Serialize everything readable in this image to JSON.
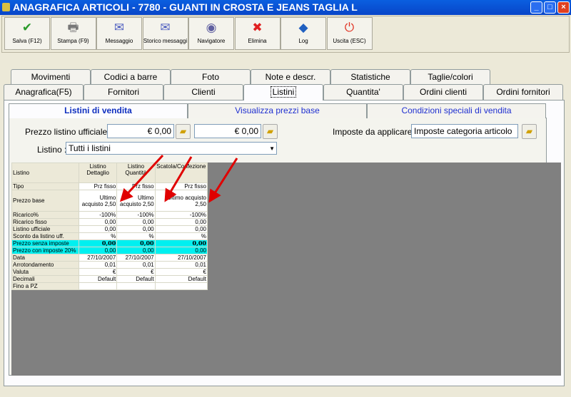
{
  "window": {
    "title": "ANAGRAFICA ARTICOLI - 7780 - GUANTI IN CROSTA E JEANS TAGLIA L"
  },
  "toolbar": [
    {
      "label": "Salva (F12)",
      "icon": "check-icon",
      "color": "#2a9a2a",
      "glyph": "✔"
    },
    {
      "label": "Stampa (F9)",
      "icon": "printer-icon",
      "color": "#777",
      "glyph": "🖶"
    },
    {
      "label": "Messaggio",
      "icon": "mail-pen-icon",
      "color": "#5060c0",
      "glyph": "✉"
    },
    {
      "label": "Storico messaggi",
      "icon": "mail-search-icon",
      "color": "#5060c0",
      "glyph": "✉"
    },
    {
      "label": "Navigatore",
      "icon": "compass-icon",
      "color": "#6060a0",
      "glyph": "◉"
    },
    {
      "label": "Elimina",
      "icon": "x-icon",
      "color": "#e02020",
      "glyph": "✖"
    },
    {
      "label": "Log",
      "icon": "book-search-icon",
      "color": "#2060c0",
      "glyph": "◆"
    },
    {
      "label": "Uscita (ESC)",
      "icon": "power-icon",
      "color": "#e03020",
      "glyph": "⏻"
    }
  ],
  "tabs_row1": [
    "Movimenti",
    "Codici a barre",
    "Foto",
    "Note e descr.",
    "Statistiche",
    "Taglie/colori"
  ],
  "tabs_row2": [
    "Anagrafica(F5)",
    "Fornitori",
    "Clienti",
    "Listini",
    "Quantita'",
    "Ordini clienti",
    "Ordini fornitori"
  ],
  "subtabs": [
    "Listini di vendita",
    "Visualizza prezzi base",
    "Condizioni speciali di vendita"
  ],
  "form": {
    "prezzo_label": "Prezzo listino ufficiale :",
    "prezzo1": "€ 0,00",
    "prezzo2": "€ 0,00",
    "imposte_label": "Imposte da applicare :",
    "imposte_value": "Imposte categoria articolo",
    "listino_label": "Listino :",
    "listino_value": "Tutti i listini"
  },
  "table": {
    "headers": [
      "Listino",
      "Listino Dettaglio",
      "Listino Quantità",
      "Scatola/Confezione"
    ],
    "rows": [
      {
        "label": "Tipo",
        "values": [
          "Prz fisso",
          "Prz fisso",
          "Prz fisso"
        ]
      },
      {
        "label": "Prezzo base",
        "values": [
          "Ultimo acquisto 2,50",
          "Ultimo acquisto 2,50",
          "Ultimo acquisto 2,50"
        ]
      },
      {
        "label": "Ricarico%",
        "values": [
          "-100%",
          "-100%",
          "-100%"
        ]
      },
      {
        "label": "Ricarico fisso",
        "values": [
          "0,00",
          "0,00",
          "0,00"
        ]
      },
      {
        "label": "Listino ufficiale",
        "values": [
          "0,00",
          "0,00",
          "0,00"
        ]
      },
      {
        "label": "Sconto da listino uff.",
        "values": [
          "%",
          "%",
          "%"
        ]
      },
      {
        "label": "Prezzo senza imposte",
        "values": [
          "0,00",
          "0,00",
          "0,00"
        ]
      },
      {
        "label": "Prezzo con imposte 20%",
        "values": [
          "0,00",
          "0,00",
          "0,00"
        ]
      },
      {
        "label": "Data",
        "values": [
          "27/10/2007",
          "27/10/2007",
          "27/10/2007"
        ]
      },
      {
        "label": "Arrotondamento",
        "values": [
          "0,01",
          "0,01",
          "0,01"
        ]
      },
      {
        "label": "Valuta",
        "values": [
          "€",
          "€",
          "€"
        ]
      },
      {
        "label": "Decimali",
        "values": [
          "Default",
          "Default",
          "Default"
        ]
      },
      {
        "label": "Fino a PZ",
        "values": [
          "",
          "",
          ""
        ]
      }
    ]
  },
  "colors": {
    "highlight": "#00f0f0",
    "arrow": "#e00000"
  }
}
